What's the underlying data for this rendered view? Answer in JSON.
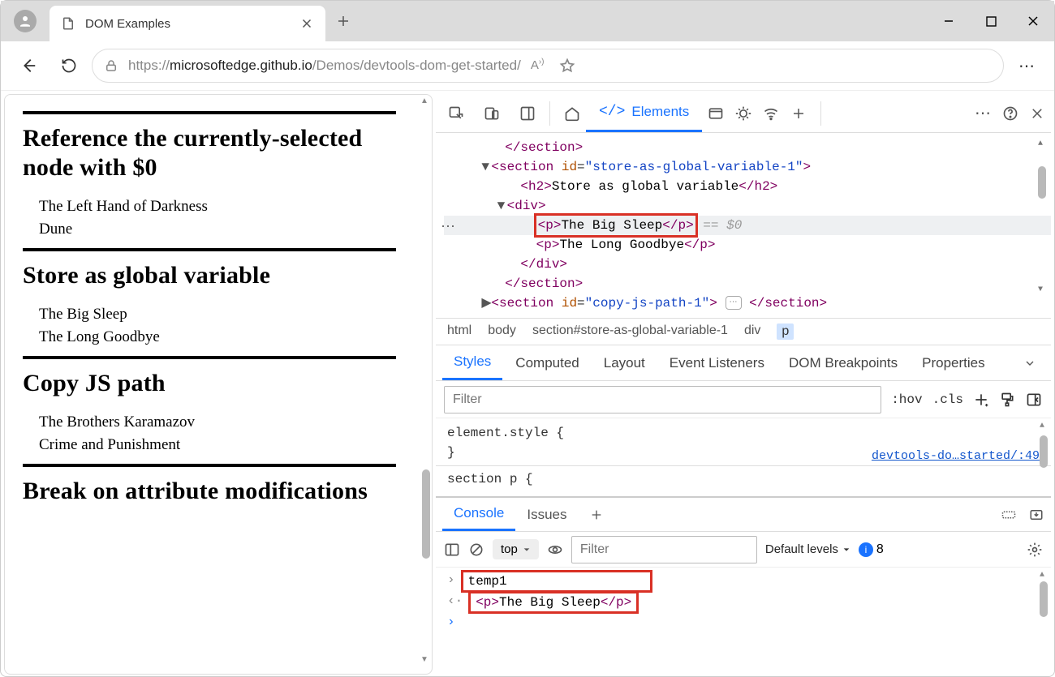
{
  "browser": {
    "tab_title": "DOM Examples",
    "url_prefix": "https://",
    "url_host": "microsoftedge.github.io",
    "url_path": "/Demos/devtools-dom-get-started/"
  },
  "page": {
    "sections": [
      {
        "title": "Reference the currently-selected node with $0",
        "items": [
          "The Left Hand of Darkness",
          "Dune"
        ]
      },
      {
        "title": "Store as global variable",
        "items": [
          "The Big Sleep",
          "The Long Goodbye"
        ]
      },
      {
        "title": "Copy JS path",
        "items": [
          "The Brothers Karamazov",
          "Crime and Punishment"
        ]
      },
      {
        "title": "Break on attribute modifications",
        "items": []
      }
    ]
  },
  "devtools": {
    "active_tab": "Elements",
    "dom": {
      "close_section": "</section>",
      "open_store": {
        "tag": "section",
        "attr": "id",
        "val": "\"store-as-global-variable-1\"",
        "close": ">"
      },
      "h2": {
        "open": "<h2>",
        "text": "Store as global variable",
        "close": "</h2>"
      },
      "div_open": "<div>",
      "p1": {
        "open": "<p>",
        "text": "The Big Sleep",
        "close": "</p>"
      },
      "sel_hint": "== $0",
      "p2": {
        "open": "<p>",
        "text": "The Long Goodbye",
        "close": "</p>"
      },
      "div_close": "</div>",
      "close_section2": "</section>",
      "open_copy": {
        "tag": "section",
        "attr": "id",
        "val": "\"copy-js-path-1\"",
        "close": ">",
        "end": "</section>"
      }
    },
    "breadcrumb": [
      "html",
      "body",
      "section#store-as-global-variable-1",
      "div",
      "p"
    ],
    "styles": {
      "tabs": [
        "Styles",
        "Computed",
        "Layout",
        "Event Listeners",
        "DOM Breakpoints",
        "Properties"
      ],
      "filter_placeholder": "Filter",
      "hov": ":hov",
      "cls": ".cls",
      "rule1a": "element.style {",
      "rule1b": "}",
      "rule2": "section p {",
      "src": "devtools-do…started/:49"
    },
    "drawer": {
      "tabs": [
        "Console",
        "Issues"
      ],
      "ctx": "top",
      "filter_placeholder": "Filter",
      "levels": "Default levels",
      "issues_count": "8",
      "line1": "temp1",
      "line2": {
        "open": "<p>",
        "text": "The Big Sleep",
        "close": "</p>"
      }
    }
  }
}
